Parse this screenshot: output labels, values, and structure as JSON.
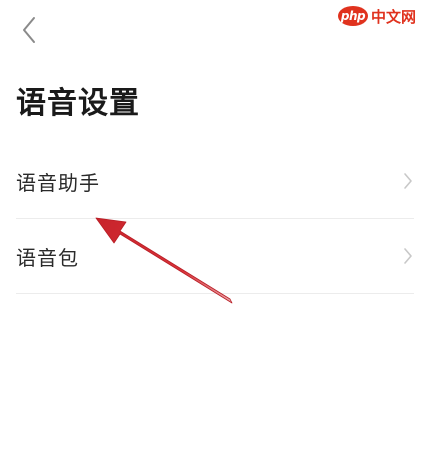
{
  "header": {
    "back_icon": "chevron-left-icon",
    "watermark_logo": "php",
    "watermark_text": "中文网"
  },
  "page": {
    "title": "语音设置"
  },
  "settings": {
    "items": [
      {
        "label": "语音助手",
        "icon": "chevron-right-icon"
      },
      {
        "label": "语音包",
        "icon": "chevron-right-icon"
      }
    ]
  },
  "colors": {
    "background": "#ffffff",
    "title_text": "#1a1a1a",
    "item_text": "#2a2a2a",
    "divider": "#ececec",
    "chevron": "#c8c8c8",
    "annotation_arrow": "#d8333a",
    "watermark": "#e0321e"
  }
}
